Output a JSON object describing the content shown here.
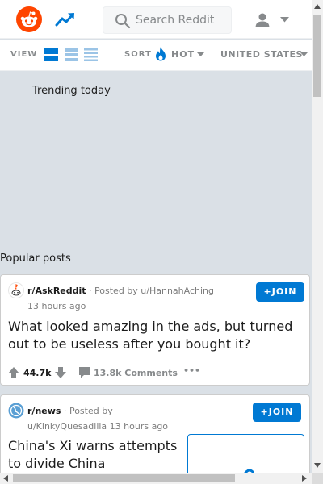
{
  "header": {
    "search_placeholder": "Search Reddit"
  },
  "sortbar": {
    "view_label": "VIEW",
    "sort_label": "SORT",
    "sort_value": "HOT",
    "region_value": "UNITED STATES"
  },
  "sections": {
    "trending": "Trending today",
    "popular": "Popular posts"
  },
  "posts": [
    {
      "subreddit": "r/AskReddit",
      "separator": "·",
      "posted_by": "Posted by u/HannahAching",
      "time": "13 hours ago",
      "join": "+JOIN",
      "title": "What looked amazing in the ads, but turned out to be useless after you bought it?",
      "score": "44.7k",
      "comments": "13.8k Comments",
      "more": "•••"
    },
    {
      "subreddit": "r/news",
      "separator": "·",
      "posted_by": "Posted by",
      "author_time": "u/KinkyQuesadilla 13 hours ago",
      "join": "+JOIN",
      "title": "China's Xi warns attempts to divide China"
    }
  ],
  "colors": {
    "brand": "#ff4500",
    "accent": "#0079d3",
    "background": "#dae0e6"
  },
  "icons": {
    "logo": "reddit-logo-icon",
    "trending": "trending-icon",
    "search": "search-icon",
    "user": "user-icon",
    "flame": "flame-icon",
    "upvote": "upvote-icon",
    "downvote": "downvote-icon",
    "comment": "comment-icon"
  }
}
